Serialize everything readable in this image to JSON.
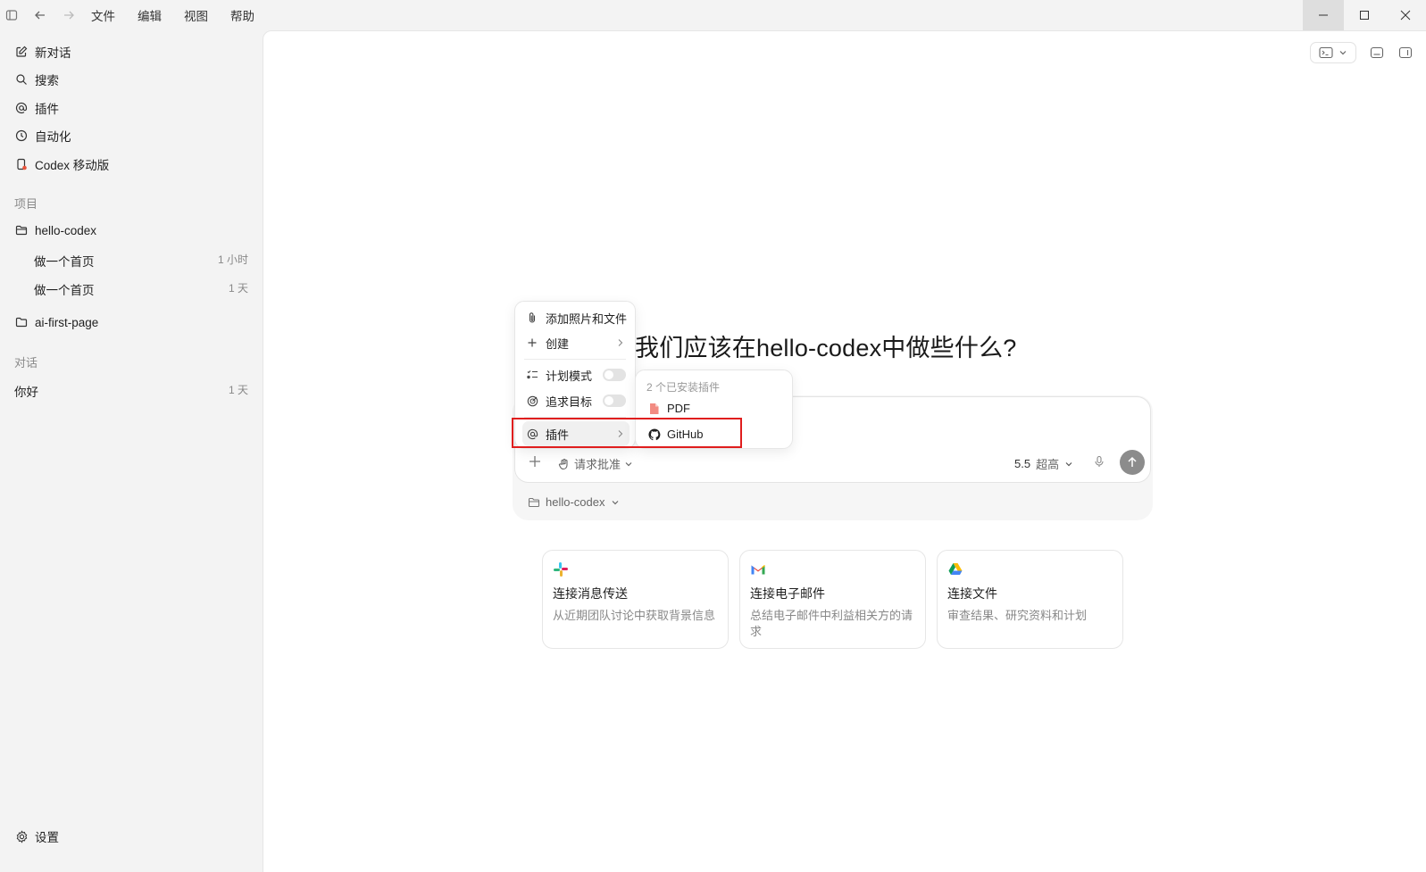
{
  "titlebar": {
    "menus": [
      "文件",
      "编辑",
      "视图",
      "帮助"
    ]
  },
  "sidebar": {
    "nav": [
      {
        "label": "新对话",
        "icon": "edit-icon"
      },
      {
        "label": "搜索",
        "icon": "search-icon"
      },
      {
        "label": "插件",
        "icon": "at-icon"
      },
      {
        "label": "自动化",
        "icon": "clock-icon"
      },
      {
        "label": "Codex 移动版",
        "icon": "phone-icon"
      }
    ],
    "projects_label": "项目",
    "projects": [
      {
        "name": "hello-codex",
        "threads": [
          {
            "title": "做一个首页",
            "time": "1 小时"
          },
          {
            "title": "做一个首页",
            "time": "1 天"
          }
        ]
      },
      {
        "name": "ai-first-page",
        "threads": []
      }
    ],
    "chats_label": "对话",
    "chats": [
      {
        "title": "你好",
        "time": "1 天"
      }
    ],
    "settings_label": "设置"
  },
  "main": {
    "headline": "我们应该在hello-codex中做些什么?",
    "composer": {
      "approval_label": "请求批准",
      "model_version": "5.5",
      "model_quality": "超高"
    },
    "project_selector": "hello-codex",
    "cards": [
      {
        "title": "连接消息传送",
        "desc": "从近期团队讨论中获取背景信息",
        "icon": "slack-icon"
      },
      {
        "title": "连接电子邮件",
        "desc": "总结电子邮件中利益相关方的请求",
        "icon": "gmail-icon"
      },
      {
        "title": "连接文件",
        "desc": "审查结果、研究资料和计划",
        "icon": "drive-icon"
      }
    ]
  },
  "menu": {
    "add_files": "添加照片和文件",
    "create": "创建",
    "plan_mode": "计划模式",
    "goal": "追求目标",
    "plugins": "插件"
  },
  "submenu": {
    "header": "2 个已安装插件",
    "items": [
      {
        "label": "PDF",
        "icon": "pdf-icon"
      },
      {
        "label": "GitHub",
        "icon": "github-icon"
      }
    ]
  },
  "colors": {
    "highlight": "#e01e1e",
    "send_button": "#8c8c8c"
  }
}
